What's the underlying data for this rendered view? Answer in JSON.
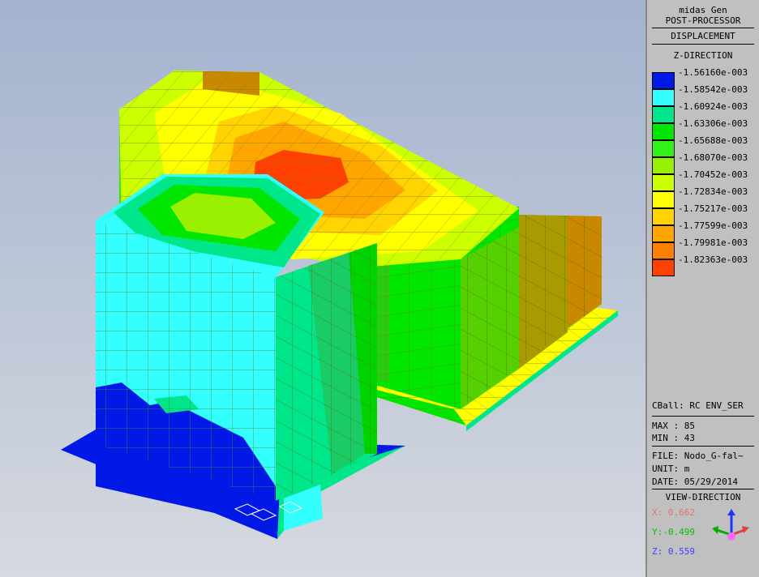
{
  "header": {
    "app_name": "midas Gen",
    "module": "POST-PROCESSOR",
    "result_type": "DISPLACEMENT",
    "component": "Z-DIRECTION"
  },
  "legend": {
    "values": [
      "-1.56160e-003",
      "-1.58542e-003",
      "-1.60924e-003",
      "-1.63306e-003",
      "-1.65688e-003",
      "-1.68070e-003",
      "-1.70452e-003",
      "-1.72834e-003",
      "-1.75217e-003",
      "-1.77599e-003",
      "-1.79981e-003",
      "-1.82363e-003"
    ],
    "colors": [
      "#0019e6",
      "#33ffff",
      "#00e68a",
      "#00e600",
      "#33f21a",
      "#99f000",
      "#ccff00",
      "#ffff00",
      "#ffd400",
      "#ffa600",
      "#ff7f00",
      "#ff4000"
    ]
  },
  "info": {
    "load_case": "CBall: RC ENV_SER",
    "max": "MAX : 85",
    "min": "MIN : 43",
    "file": "FILE: Nodo_G-fal~",
    "unit": "UNIT: m",
    "date": "DATE: 05/29/2014"
  },
  "view": {
    "title": "VIEW-DIRECTION",
    "x": "X: 0.662",
    "y": "Y:-0.499",
    "z": "Z: 0.559",
    "x_color": "#e87070",
    "y_color": "#00c000",
    "z_color": "#4040ff"
  }
}
